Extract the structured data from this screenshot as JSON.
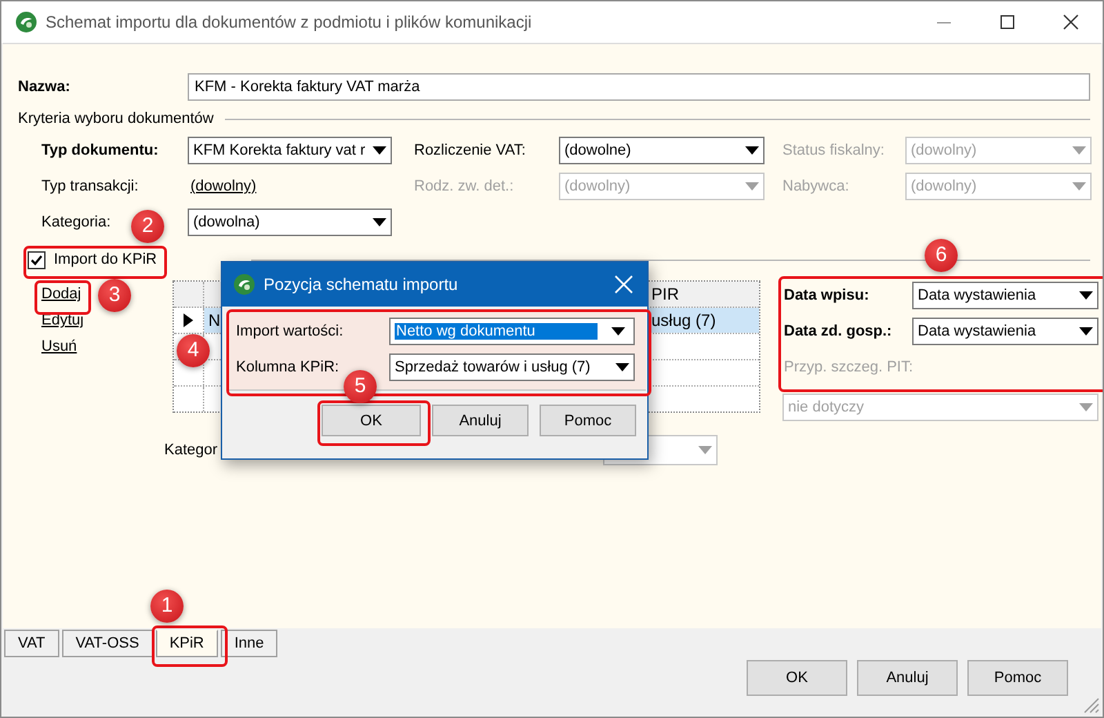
{
  "window": {
    "title": "Schemat importu dla dokumentów z podmiotu i plików komunikacji"
  },
  "name_field": {
    "label": "Nazwa:",
    "value": "KFM - Korekta faktury VAT marża"
  },
  "criteria": {
    "title": "Kryteria wyboru dokumentów",
    "rows": [
      [
        {
          "label": "Typ dokumentu:",
          "kind": "select",
          "value": "KFM Korekta faktury vat r",
          "required": true,
          "disabled": false
        },
        {
          "label": "Rozliczenie VAT:",
          "kind": "select",
          "value": "(dowolne)",
          "required": false,
          "disabled": false
        },
        {
          "label": "Status fiskalny:",
          "kind": "select",
          "value": "(dowolny)",
          "required": false,
          "disabled": true
        }
      ],
      [
        {
          "label": "Typ transakcji:",
          "kind": "link",
          "value": "(dowolny)",
          "required": false,
          "disabled": false
        },
        {
          "label": "Rodz. zw. det.:",
          "kind": "select",
          "value": "(dowolny)",
          "required": false,
          "disabled": true
        },
        {
          "label": "Nabywca:",
          "kind": "select",
          "value": "(dowolny)",
          "required": false,
          "disabled": true
        }
      ],
      [
        {
          "label": "Kategoria:",
          "kind": "select",
          "value": "(dowolna)",
          "required": false,
          "disabled": false
        }
      ]
    ]
  },
  "import_checkbox": {
    "label": "Import do KPiR",
    "checked": true
  },
  "actions": [
    {
      "label": "Dodaj"
    },
    {
      "label": "Edytuj"
    },
    {
      "label": "Usuń"
    }
  ],
  "grid": {
    "header": "PIR",
    "rows": [
      {
        "cells": [
          "N",
          "usług (7)"
        ],
        "selected": true
      },
      {
        "cells": [],
        "selected": false
      },
      {
        "cells": [],
        "selected": false
      },
      {
        "cells": [],
        "selected": false
      }
    ]
  },
  "category_row": {
    "label": "Kategor",
    "disabled": true
  },
  "dates": {
    "fields": [
      {
        "label": "Data wpisu:",
        "kind": "select",
        "value": "Data wystawienia",
        "required": true,
        "disabled": false
      },
      {
        "label": "Data zd. gosp.:",
        "kind": "select",
        "value": "Data wystawienia",
        "required": true,
        "disabled": false
      },
      {
        "label": "Przyp. szczeg. PIT:",
        "kind": "label",
        "required": false,
        "disabled": true
      }
    ],
    "pit_select": {
      "value": "nie dotyczy",
      "disabled": true
    }
  },
  "tabs": [
    {
      "label": "VAT",
      "selected": false
    },
    {
      "label": "VAT-OSS",
      "selected": false
    },
    {
      "label": "KPiR",
      "selected": true
    },
    {
      "label": "Inne",
      "selected": false
    }
  ],
  "buttons": [
    "OK",
    "Anuluj",
    "Pomoc"
  ],
  "dialog": {
    "title": "Pozycja schematu importu",
    "fields": [
      {
        "label": "Import wartości:",
        "value": "Netto wg dokumentu",
        "selected": true
      },
      {
        "label": "Kolumna KPiR:",
        "value": "Sprzedaż towarów i usług (7)",
        "selected": false
      }
    ],
    "buttons": [
      "OK",
      "Anuluj",
      "Pomoc"
    ]
  },
  "callouts": [
    {
      "number": "1"
    },
    {
      "number": "2"
    },
    {
      "number": "3"
    },
    {
      "number": "4"
    },
    {
      "number": "5"
    },
    {
      "number": "6"
    }
  ]
}
